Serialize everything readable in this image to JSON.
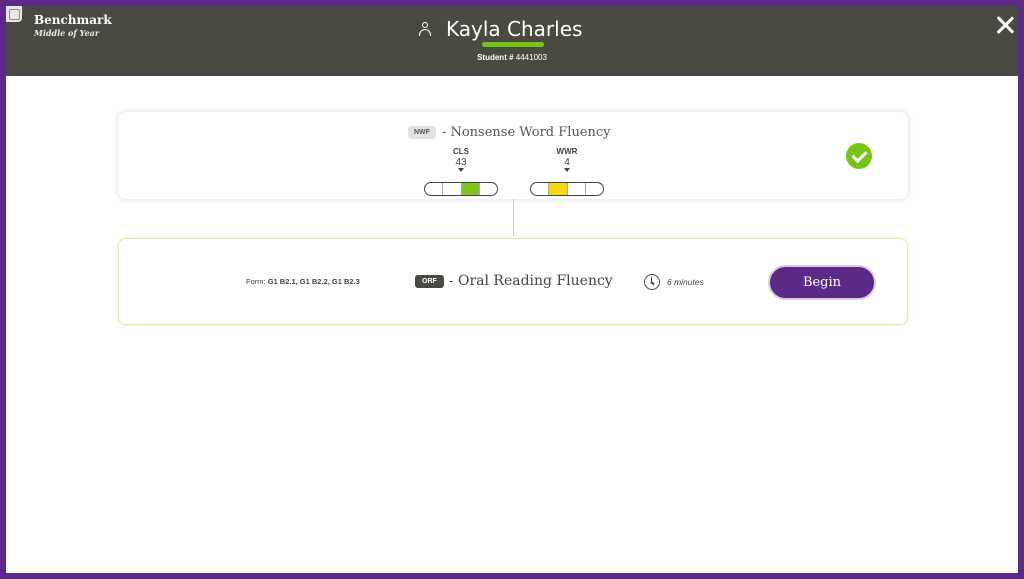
{
  "header": {
    "title": "Benchmark",
    "subtitle": "Middle of Year",
    "student_name": "Kayla Charles",
    "student_id_label": "Student #",
    "student_id": "4441003",
    "accent_color": "#78c316"
  },
  "completed_measure": {
    "tag": "NWF",
    "name": "- Nonsense Word Fluency",
    "status": "complete",
    "metrics": [
      {
        "label": "CLS",
        "value": "43",
        "bar_color": "green",
        "filled_segment": 3,
        "segments": 4
      },
      {
        "label": "WWR",
        "value": "4",
        "bar_color": "yellow",
        "filled_segment": 2,
        "segments": 4
      }
    ]
  },
  "next_measure": {
    "form_label": "Form:",
    "forms": "G1 B2.1, G1 B2.2, G1 B2.3",
    "tag": "ORF",
    "name": "- Oral Reading Fluency",
    "duration": "6 minutes",
    "begin_label": "Begin"
  },
  "colors": {
    "frame": "#5b2a86",
    "header_bg": "#4a4a43",
    "green": "#7bc51d",
    "yellow": "#f5d80f",
    "button": "#5b2a86"
  }
}
